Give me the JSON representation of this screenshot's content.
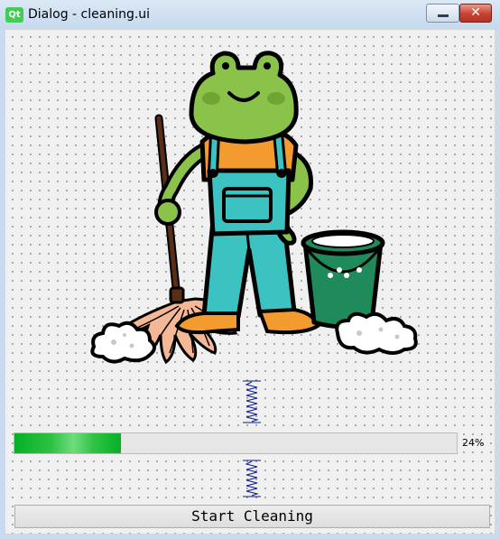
{
  "window": {
    "app_icon_text": "Qt",
    "title": "Dialog - cleaning.ui",
    "minimize_symbol": "—",
    "close_symbol": "✕",
    "frame_color": "#c9dcef",
    "close_color": "#c74132"
  },
  "illustration": {
    "subject": "frog-in-overalls-with-mop-and-bucket",
    "icon_names": [
      "frog-icon",
      "mop-icon",
      "bucket-icon",
      "soap-foam-icon"
    ]
  },
  "progress": {
    "value_fraction": 0.24,
    "label": "24%",
    "fill_color": "#06b025"
  },
  "actions": {
    "start_label": "Start Cleaning"
  }
}
